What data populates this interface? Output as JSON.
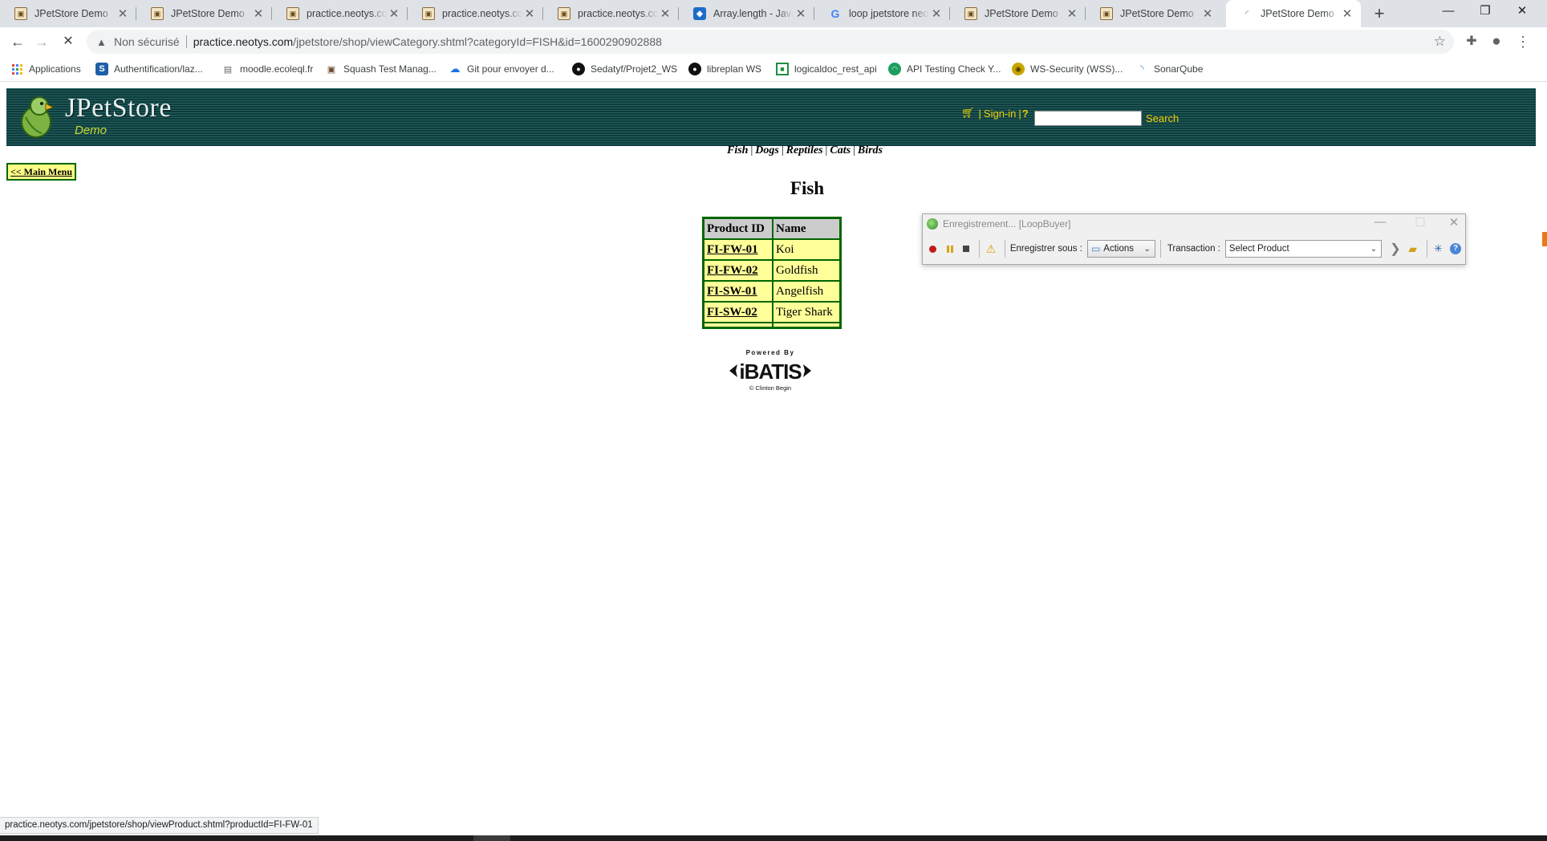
{
  "browser": {
    "tabs": [
      {
        "title": "JPetStore Demo",
        "icon": "pet-icon"
      },
      {
        "title": "JPetStore Demo",
        "icon": "pet-icon"
      },
      {
        "title": "practice.neotys.com",
        "icon": "pet-icon"
      },
      {
        "title": "practice.neotys.com",
        "icon": "pet-icon"
      },
      {
        "title": "practice.neotys.com",
        "icon": "pet-icon"
      },
      {
        "title": "Array.length - JavaScript",
        "icon": "mdn-icon"
      },
      {
        "title": "loop jpetstore neoload",
        "icon": "google-icon"
      },
      {
        "title": "JPetStore Demo",
        "icon": "pet-icon"
      },
      {
        "title": "JPetStore Demo",
        "icon": "pet-icon"
      },
      {
        "title": "JPetStore Demo",
        "icon": "loading-icon",
        "active": true
      }
    ],
    "new_tab": "+",
    "window_controls": {
      "minimize": "—",
      "restore": "❐",
      "close": "✕"
    },
    "toolbar": {
      "back": "←",
      "forward": "→",
      "reload": "✕",
      "security_label": "Non sécurisé",
      "url_host": "practice.neotys.com",
      "url_path": "/jpetstore/shop/viewCategory.shtml?categoryId=FISH&id=1600290902888",
      "bookmark_star": "☆"
    },
    "bookmarks": [
      {
        "label": "Applications",
        "icon": "apps-grid-icon"
      },
      {
        "label": "Authentification/laz...",
        "icon": "s-icon"
      },
      {
        "label": "moodle.ecoleql.fr",
        "icon": "moodle-icon"
      },
      {
        "label": "Squash Test Manag...",
        "icon": "squash-icon"
      },
      {
        "label": "Git pour envoyer d...",
        "icon": "cloud-icon"
      },
      {
        "label": "Sedatyf/Projet2_WS",
        "icon": "github-icon"
      },
      {
        "label": "libreplan WS",
        "icon": "github-icon"
      },
      {
        "label": "logicaldoc_rest_api",
        "icon": "logicaldoc-icon"
      },
      {
        "label": "API Testing Check Y...",
        "icon": "api-icon"
      },
      {
        "label": "WS-Security (WSS)...",
        "icon": "wss-icon"
      },
      {
        "label": "SonarQube",
        "icon": "sonarqube-icon"
      }
    ]
  },
  "jpetstore": {
    "logo": "JPetStore",
    "logo_sub": "Demo",
    "signin": "Sign-in",
    "sep": "|",
    "help": "?",
    "search_button": "Search",
    "search_value": "",
    "categories": [
      "Fish",
      "Dogs",
      "Reptiles",
      "Cats",
      "Birds"
    ],
    "main_menu": "<< Main Menu",
    "category_title": "Fish",
    "table": {
      "headers": [
        "Product ID",
        "Name"
      ],
      "rows": [
        {
          "id": "FI-FW-01",
          "name": "Koi"
        },
        {
          "id": "FI-FW-02",
          "name": "Goldfish"
        },
        {
          "id": "FI-SW-01",
          "name": "Angelfish"
        },
        {
          "id": "FI-SW-02",
          "name": "Tiger Shark"
        }
      ]
    },
    "footer_logo": {
      "top": "Powered By",
      "brand": "iBATIS",
      "bottom": "© Clinton Begin"
    }
  },
  "recorder": {
    "title": "Enregistrement... [LoopBuyer]",
    "record_as_label": "Enregistrer sous :",
    "record_as_value": "Actions",
    "transaction_label": "Transaction :",
    "transaction_value": "Select Product"
  },
  "status_url": "practice.neotys.com/jpetstore/shop/viewProduct.shtml?productId=FI-FW-01",
  "colors": {
    "header_dark": "#0f3c3c",
    "header_light": "#236060",
    "link_yellow": "#f0d000",
    "table_border": "#006600",
    "cell_bg": "#ffff99",
    "header_cell_bg": "#cccccc"
  }
}
